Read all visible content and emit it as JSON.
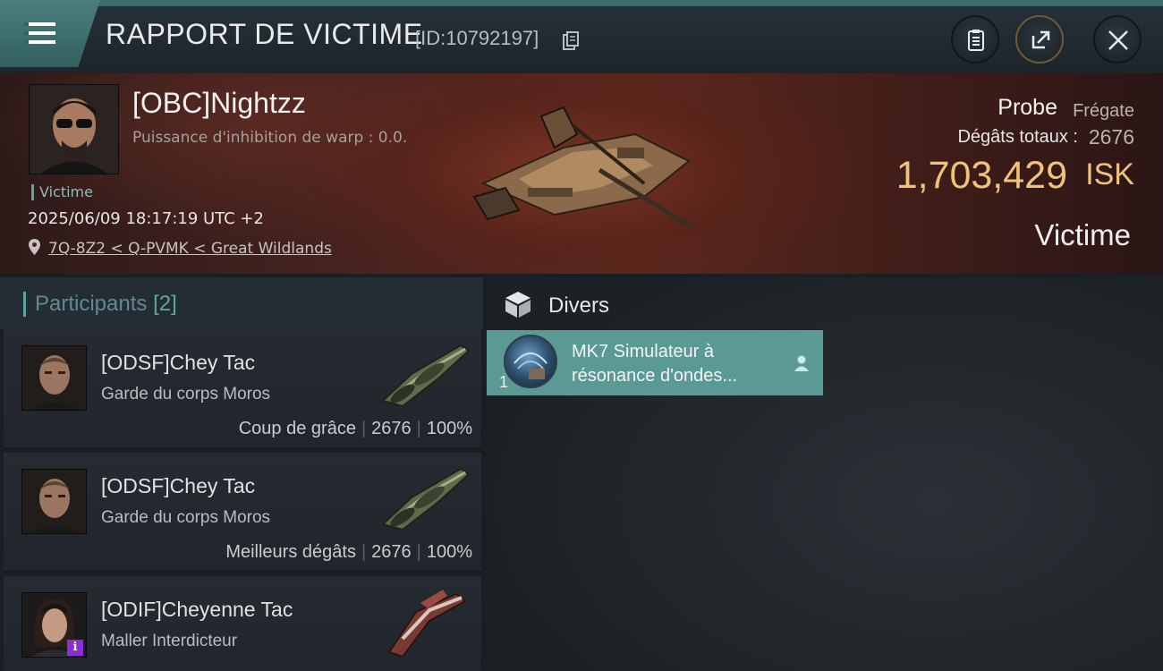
{
  "header": {
    "title": "RAPPORT DE VICTIME",
    "report_id": "[ID:10792197]",
    "icons": [
      "menu-icon",
      "copy-icon",
      "clipboard-icon",
      "share-icon",
      "close-icon"
    ]
  },
  "victim": {
    "name": "[OBC]Nightzz",
    "subtitle": "Puissance d'inhibition de warp : 0.0.",
    "tag": "Victime",
    "datetime": "2025/06/09 18:17:19 UTC +2",
    "location": "7Q-8Z2 < Q-PVMK < Great Wildlands",
    "ship_name": "Probe",
    "ship_class": "Frégate",
    "damage_label": "Dégâts totaux :",
    "damage_value": "2676",
    "isk_value": "1,703,429",
    "isk_unit": "ISK",
    "role": "Victime"
  },
  "participants": {
    "title": "Participants",
    "count": "[2]",
    "rows": [
      {
        "name": "[ODSF]Chey Tac",
        "ship": "Garde du corps Moros",
        "stat_label": "Coup de grâce",
        "damage": "2676",
        "percent": "100%"
      },
      {
        "name": "[ODSF]Chey Tac",
        "ship": "Garde du corps Moros",
        "stat_label": "Meilleurs dégâts",
        "damage": "2676",
        "percent": "100%"
      },
      {
        "name": "[ODIF]Cheyenne Tac",
        "ship": "Maller Interdicteur",
        "badge": "i"
      }
    ]
  },
  "divers": {
    "title": "Divers",
    "items": [
      {
        "qty": "1",
        "name": "MK7 Simulateur à résonance d'ondes..."
      }
    ]
  },
  "colors": {
    "accent_teal": "#5fa6a3",
    "isk_gold": "#f1c27a",
    "item_card": "#5b9a94",
    "badge_purple": "#8a2fd3"
  }
}
